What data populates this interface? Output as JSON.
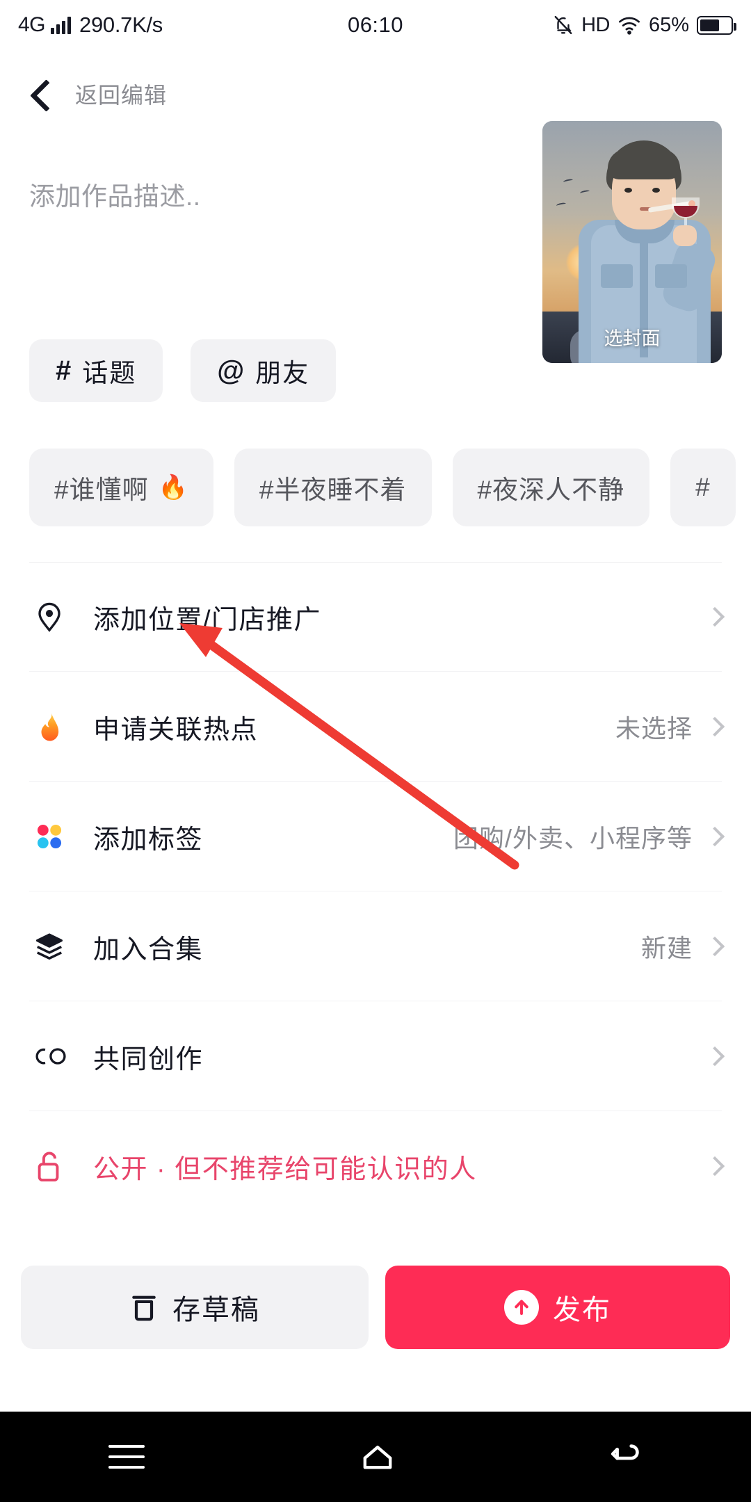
{
  "status_bar": {
    "network_type": "4G",
    "signal_icon": "signal-bars-icon",
    "speed": "290.7K/s",
    "time": "06:10",
    "mute_icon": "bell-muted-icon",
    "hd": "HD",
    "wifi_icon": "wifi-icon",
    "battery_percent": "65%",
    "battery_icon": "battery-icon"
  },
  "navbar": {
    "back_icon": "chevron-left-icon",
    "title": "返回编辑"
  },
  "description": {
    "placeholder": "添加作品描述..",
    "value": ""
  },
  "cover": {
    "label": "选封面",
    "alt": "cover-thumbnail"
  },
  "insert_chips": [
    {
      "symbol": "#",
      "label": "话题",
      "name": "topic-chip"
    },
    {
      "symbol": "@",
      "label": "朋友",
      "name": "friend-chip"
    }
  ],
  "hashtag_suggestions": [
    {
      "label": "#谁懂啊",
      "fire": "🔥"
    },
    {
      "label": "#半夜睡不着",
      "fire": ""
    },
    {
      "label": "#夜深人不静",
      "fire": ""
    },
    {
      "label": "#",
      "fire": ""
    }
  ],
  "option_rows": [
    {
      "icon": "location-pin-icon",
      "label": "添加位置/门店推广",
      "value": "",
      "arrow": "chevron-right-icon"
    },
    {
      "icon": "flame-icon",
      "label": "申请关联热点",
      "value": "未选择",
      "arrow": "chevron-right-icon"
    },
    {
      "icon": "tag-dots-icon",
      "label": "添加标签",
      "value": "团购/外卖、小程序等",
      "arrow": "chevron-right-icon"
    },
    {
      "icon": "layers-icon",
      "label": "加入合集",
      "value": "新建",
      "arrow": "chevron-right-icon"
    },
    {
      "icon": "co-create-icon",
      "label": "共同创作",
      "value": "",
      "arrow": "chevron-right-icon"
    },
    {
      "icon": "unlock-icon",
      "label": "公开 · 但不推荐给可能认识的人",
      "value": "",
      "arrow": "chevron-right-icon"
    }
  ],
  "actions": {
    "draft_icon": "save-draft-icon",
    "draft_label": "存草稿",
    "publish_icon": "arrow-up-circle-icon",
    "publish_label": "发布"
  },
  "system_nav": {
    "recents_icon": "menu-icon",
    "home_icon": "home-icon",
    "back_icon": "back-arrow-icon"
  },
  "colors": {
    "accent_red": "#fe2c55",
    "privacy_pink": "#e8456b",
    "chip_bg": "#f2f2f4",
    "muted_text": "#8a8b91",
    "annotation_arrow": "#ee3b33"
  }
}
